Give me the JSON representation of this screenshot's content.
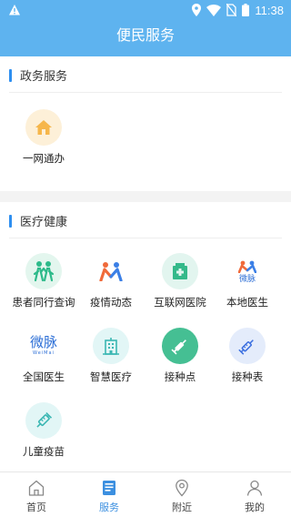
{
  "status_bar": {
    "time": "11:38"
  },
  "header": {
    "title": "便民服务"
  },
  "sections": [
    {
      "title": "政务服务",
      "items": [
        {
          "label": "一网通办",
          "icon": "house-icon"
        }
      ]
    },
    {
      "title": "医疗健康",
      "items": [
        {
          "label": "患者同行查询",
          "icon": "companions-icon"
        },
        {
          "label": "疫情动态",
          "icon": "people-logo-icon"
        },
        {
          "label": "互联网医院",
          "icon": "hospital-icon"
        },
        {
          "label": "本地医生",
          "icon": "weimai-logo-icon",
          "logo_text": "微脉"
        },
        {
          "label": "全国医生",
          "icon": "weimai-text-icon",
          "logo_text": "微脉",
          "logo_sub": "WeiMai"
        },
        {
          "label": "智慧医疗",
          "icon": "building-icon"
        },
        {
          "label": "接种点",
          "icon": "syringe-icon"
        },
        {
          "label": "接种表",
          "icon": "syringe-icon"
        },
        {
          "label": "儿童疫苗",
          "icon": "vaccine-icon"
        }
      ]
    }
  ],
  "tabbar": {
    "items": [
      {
        "label": "首页",
        "icon": "home-icon",
        "active": false
      },
      {
        "label": "服务",
        "icon": "services-icon",
        "active": true
      },
      {
        "label": "附近",
        "icon": "location-pin-icon",
        "active": false
      },
      {
        "label": "我的",
        "icon": "profile-icon",
        "active": false
      }
    ]
  },
  "colors": {
    "header": "#5eb3ef",
    "accent": "#2e8ff0",
    "tab_active": "#3b8fe0"
  }
}
